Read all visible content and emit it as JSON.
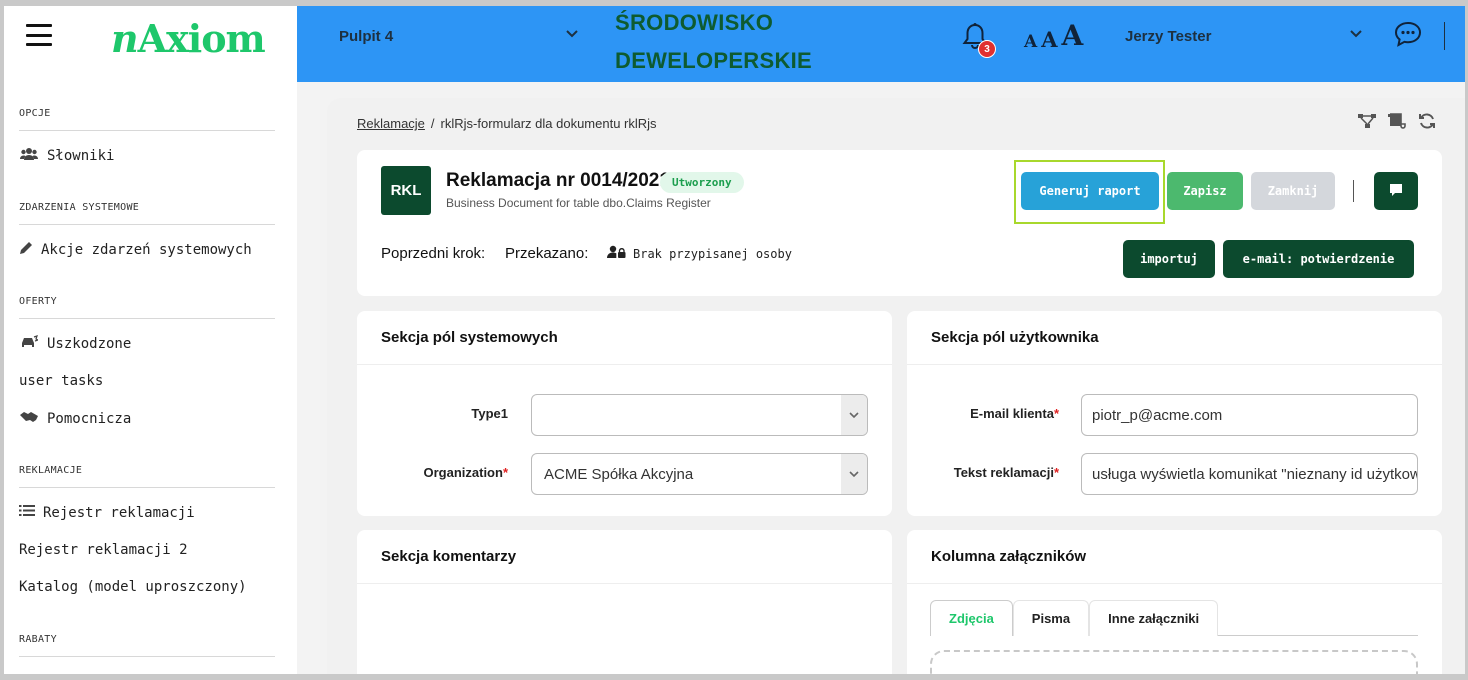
{
  "sidebar": {
    "logo": {
      "prefix": "n",
      "rest": "Axiom"
    },
    "sections": [
      {
        "heading": "OPCJE",
        "items": [
          {
            "label": "Słowniki",
            "icon": "users-icon"
          }
        ]
      },
      {
        "heading": "ZDARZENIA SYSTEMOWE",
        "items": [
          {
            "label": "Akcje zdarzeń systemowych",
            "icon": "pencil-icon"
          }
        ]
      },
      {
        "heading": "OFERTY",
        "items": [
          {
            "label": "Uszkodzone",
            "icon": "car-crash-icon"
          },
          {
            "label": "user tasks",
            "icon": ""
          },
          {
            "label": "Pomocnicza",
            "icon": "handshake-icon"
          }
        ]
      },
      {
        "heading": "REKLAMACJE",
        "items": [
          {
            "label": "Rejestr reklamacji",
            "icon": "list-icon"
          },
          {
            "label": "Rejestr reklamacji 2",
            "icon": ""
          },
          {
            "label": "Katalog (model uproszczony)",
            "icon": ""
          }
        ]
      },
      {
        "heading": "RABATY",
        "items": []
      }
    ]
  },
  "topbar": {
    "dashboard": "Pulpit 4",
    "environment_line1": "ŚRODOWISKO",
    "environment_line2": "DEWELOPERSKIE",
    "notifications_count": "3",
    "font_size_labels": [
      "A",
      "A",
      "A"
    ],
    "user_name": "Jerzy Tester",
    "accent_color": "#2d95f5"
  },
  "breadcrumb": {
    "parent": "Reklamacje",
    "separator": "/",
    "current": "rklRjs-formularz dla dokumentu rklRjs"
  },
  "document": {
    "badge": "RKL",
    "title": "Reklamacja nr 0014/2021",
    "status": "Utworzony",
    "subtitle": "Business Document for table dbo.Claims Register",
    "buttons": {
      "generate_report": "Generuj raport",
      "save": "Zapisz",
      "close": "Zamknij",
      "import": "importuj",
      "email_confirmation": "e-mail: potwierdzenie"
    },
    "previous_step_label": "Poprzedni krok:",
    "passed_to_label": "Przekazano:",
    "assignee": "Brak przypisanej osoby"
  },
  "system_section": {
    "title": "Sekcja pól systemowych",
    "fields": [
      {
        "label": "Type1",
        "required": false,
        "value": ""
      },
      {
        "label": "Organization",
        "required": true,
        "value": "ACME Spółka Akcyjna"
      }
    ]
  },
  "user_section": {
    "title": "Sekcja pól użytkownika",
    "fields": [
      {
        "label": "E-mail klienta",
        "required": true,
        "value": "piotr_p@acme.com"
      },
      {
        "label": "Tekst reklamacji",
        "required": true,
        "value": "usługa wyświetla komunikat \"nieznany id użytkownika\""
      }
    ]
  },
  "comments_section": {
    "title": "Sekcja komentarzy"
  },
  "attachments_section": {
    "title": "Kolumna załączników",
    "tabs": [
      "Zdjęcia",
      "Pisma",
      "Inne załączniki"
    ],
    "active_tab": "Zdjęcia"
  },
  "colors": {
    "brand_green": "#1ec76b",
    "dark_green": "#0c4a2e",
    "generate_blue": "#27a2d8",
    "save_green": "#4cb96e",
    "highlight": "#a8d82c"
  }
}
